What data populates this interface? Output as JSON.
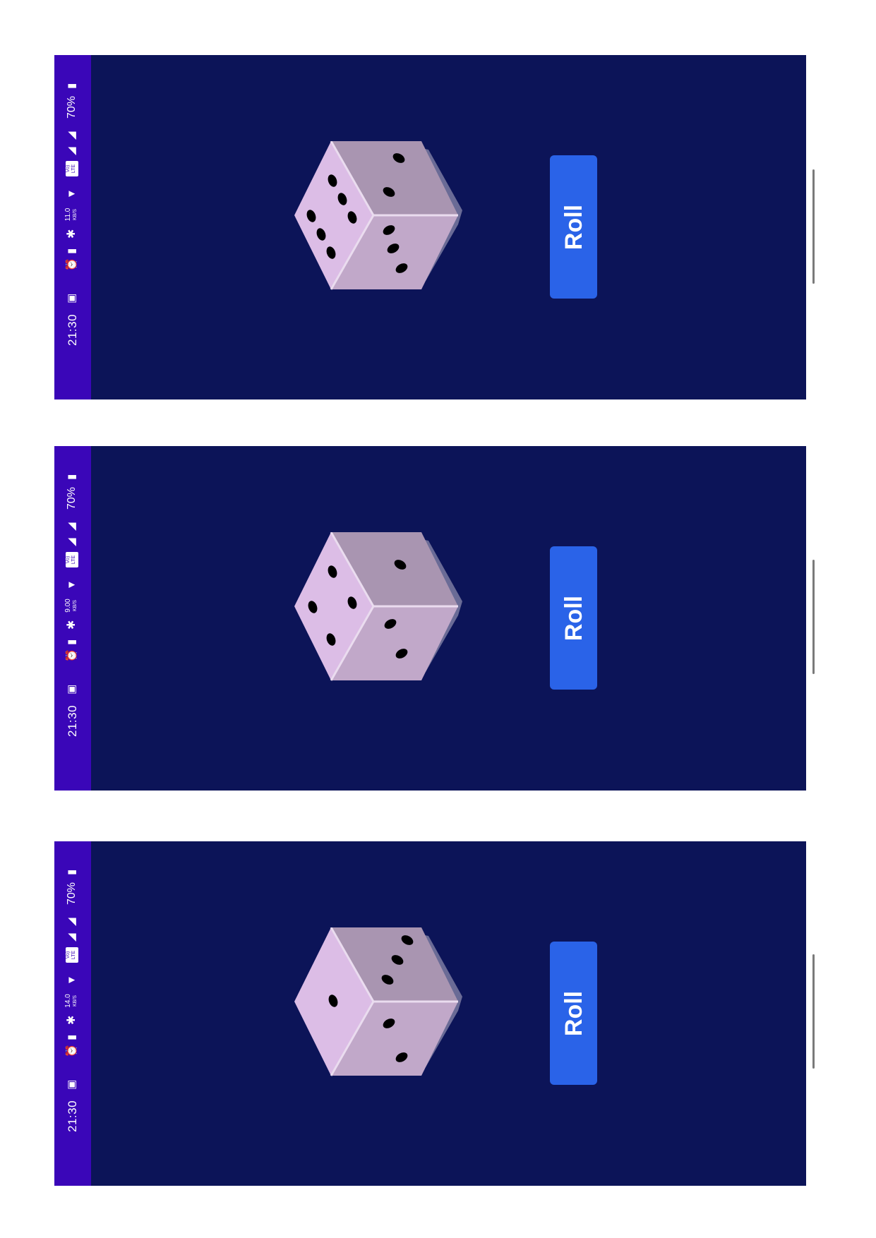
{
  "screens": [
    {
      "status": {
        "time": "21:30",
        "net_speed_value": "11.0",
        "net_speed_unit": "KB/S",
        "volte_label": "Vo) LTE",
        "battery": "70%"
      },
      "dice": {
        "left_face_pips": 6,
        "top_face_pips": 2,
        "right_face_pips": 3
      },
      "roll_label": "Roll"
    },
    {
      "status": {
        "time": "21:30",
        "net_speed_value": "9.00",
        "net_speed_unit": "KB/S",
        "volte_label": "Vo) LTE",
        "battery": "70%"
      },
      "dice": {
        "left_face_pips": 4,
        "top_face_pips": 1,
        "right_face_pips": 2
      },
      "roll_label": "Roll"
    },
    {
      "status": {
        "time": "21:30",
        "net_speed_value": "14.0",
        "net_speed_unit": "KB/S",
        "volte_label": "Vo) LTE",
        "battery": "70%"
      },
      "dice": {
        "left_face_pips": 1,
        "top_face_pips": 3,
        "right_face_pips": 2
      },
      "roll_label": "Roll"
    }
  ],
  "colors": {
    "app_background": "#0c1458",
    "status_bar": "#3a06b8",
    "roll_button": "#2a63e8",
    "dice_left_face": "#dcbde6",
    "dice_top_face": "#a995b1",
    "dice_right_face": "#c1a8c9",
    "dice_shadow": "#6a6b96"
  },
  "icons": [
    "sim-icon",
    "alarm-icon",
    "vibrate-icon",
    "bluetooth-icon",
    "wifi-icon",
    "signal-icon",
    "battery-icon"
  ]
}
